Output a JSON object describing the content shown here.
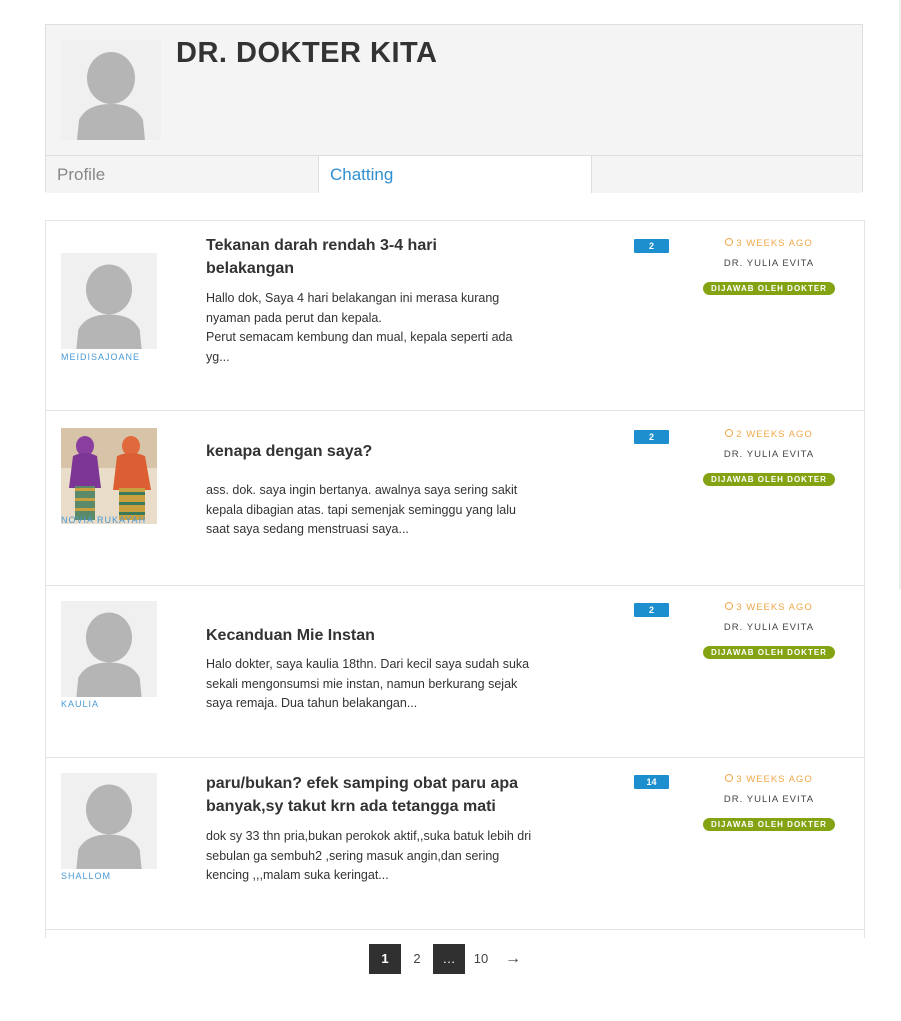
{
  "profile": {
    "name": "DR. DOKTER KITA",
    "tabs": [
      {
        "label": "Profile",
        "active": false
      },
      {
        "label": "Chatting",
        "active": true
      }
    ]
  },
  "threads": [
    {
      "user": "MEIDISAJOANE",
      "avatar": "default-avatar",
      "title": "Tekanan darah rendah 3-4 hari belakangan",
      "excerpt_lines": [
        "Hallo dok, Saya 4 hari belakangan ini merasa kurang nyaman pada perut dan kepala.",
        "Perut semacam kembung dan mual, kepala seperti ada yg..."
      ],
      "replies": "2",
      "time": "3 WEEKS AGO",
      "doctor": "DR. YULIA EVITA",
      "status": "DIJAWAB OLEH DOKTER"
    },
    {
      "user": "NOVIA RUKAYAH",
      "avatar": "photo-avatar",
      "title": "kenapa dengan saya?",
      "excerpt_lines": [
        "ass. dok. saya ingin bertanya. awalnya saya sering sakit kepala dibagian atas. tapi semenjak seminggu yang lalu saat saya sedang menstruasi saya..."
      ],
      "replies": "2",
      "time": "2 WEEKS AGO",
      "doctor": "DR. YULIA EVITA",
      "status": "DIJAWAB OLEH DOKTER"
    },
    {
      "user": "KAULIA",
      "avatar": "default-avatar",
      "title": "Kecanduan Mie Instan",
      "excerpt_lines": [
        "Halo dokter, saya kaulia 18thn. Dari kecil saya sudah suka sekali mengonsumsi mie instan, namun berkurang sejak saya remaja. Dua tahun belakangan..."
      ],
      "replies": "2",
      "time": "3 WEEKS AGO",
      "doctor": "DR. YULIA EVITA",
      "status": "DIJAWAB OLEH DOKTER"
    },
    {
      "user": "SHALLOM",
      "avatar": "default-avatar",
      "title": "paru/bukan? efek samping obat paru apa banyak,sy takut krn ada tetangga mati",
      "excerpt_lines": [
        "dok sy 33 thn pria,bukan perokok aktif,,suka batuk lebih dri sebulan ga sembuh2 ,sering masuk angin,dan sering kencing ,,,malam suka keringat..."
      ],
      "replies": "14",
      "time": "3 WEEKS AGO",
      "doctor": "DR. YULIA EVITA",
      "status": "DIJAWAB OLEH DOKTER"
    }
  ],
  "pagination": {
    "pages": [
      "1",
      "2",
      "…",
      "10",
      "→"
    ],
    "current": "1"
  },
  "colors": {
    "accent": "#2f8fd0",
    "badge_green": "#84a313",
    "time_orange": "#f0a848",
    "count_blue": "#1e8fce"
  }
}
